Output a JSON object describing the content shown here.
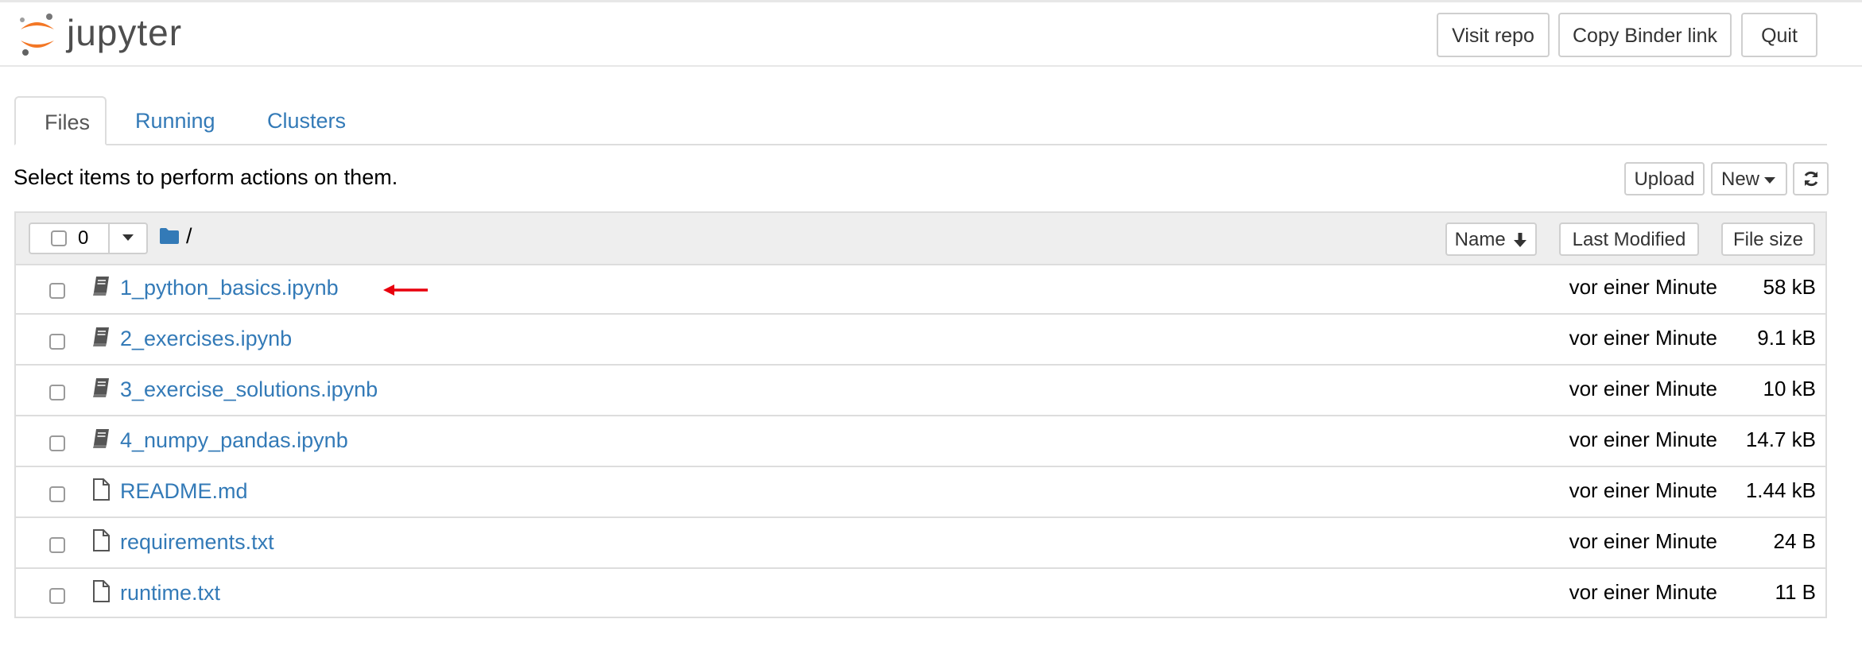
{
  "header": {
    "logo_text": "jupyter",
    "buttons": {
      "visit_repo": "Visit repo",
      "copy_binder": "Copy Binder link",
      "quit": "Quit"
    }
  },
  "tabs": [
    {
      "label": "Files",
      "active": true
    },
    {
      "label": "Running",
      "active": false
    },
    {
      "label": "Clusters",
      "active": false
    }
  ],
  "toolbar": {
    "instructions": "Select items to perform actions on them.",
    "upload_label": "Upload",
    "new_label": "New",
    "refresh_icon": "refresh-icon"
  },
  "list_header": {
    "selected_count": "0",
    "breadcrumb_path": "/",
    "folder_icon": "folder-icon",
    "sort_name_label": "Name",
    "sort_direction_icon": "arrow-down-icon",
    "last_modified_label": "Last Modified",
    "file_size_label": "File size"
  },
  "files": [
    {
      "name": "1_python_basics.ipynb",
      "type": "notebook",
      "modified": "vor einer Minute",
      "size": "58 kB",
      "highlighted": true
    },
    {
      "name": "2_exercises.ipynb",
      "type": "notebook",
      "modified": "vor einer Minute",
      "size": "9.1 kB"
    },
    {
      "name": "3_exercise_solutions.ipynb",
      "type": "notebook",
      "modified": "vor einer Minute",
      "size": "10 kB"
    },
    {
      "name": "4_numpy_pandas.ipynb",
      "type": "notebook",
      "modified": "vor einer Minute",
      "size": "14.7 kB"
    },
    {
      "name": "README.md",
      "type": "file",
      "modified": "vor einer Minute",
      "size": "1.44 kB"
    },
    {
      "name": "requirements.txt",
      "type": "file",
      "modified": "vor einer Minute",
      "size": "24 B"
    },
    {
      "name": "runtime.txt",
      "type": "file",
      "modified": "vor einer Minute",
      "size": "11 B"
    }
  ],
  "colors": {
    "link": "#337ab7",
    "logo_orange": "#f37726",
    "annotation_arrow": "#e8000d",
    "header_row_bg": "#eeeeee"
  }
}
